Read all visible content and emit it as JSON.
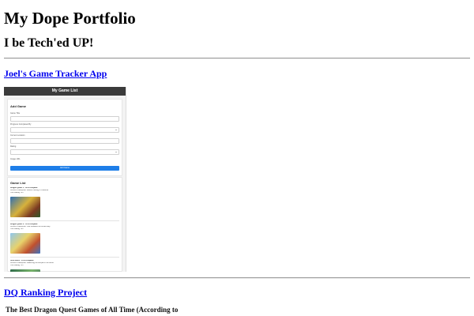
{
  "header": {
    "title": "My Dope Portfolio",
    "subtitle": "I be Tech'ed UP!"
  },
  "projects": [
    {
      "link_text": "Joel's Game Tracker App",
      "thumbnail": {
        "header_title": "My Game List",
        "add_section_title": "Add Game",
        "fields": [
          {
            "label": "Game Title"
          },
          {
            "label": "Progress Completed By"
          },
          {
            "label": "Current Location"
          },
          {
            "label": "Rating"
          },
          {
            "label": "Image URL"
          }
        ],
        "add_button_label": "Add Game",
        "list_title": "Game List",
        "games": [
          {
            "line1": "Dragon Quest 1 - 60% complete",
            "line2": "Current Checkpoint: Before moving to Charlock",
            "line3": "Your Rating: 3/5"
          },
          {
            "line1": "Dragon Quest 2 - 45% complete",
            "line2": "Current Checkpoint: Just obtained the Wizard key",
            "line3": "Your Rating: 4/5"
          },
          {
            "line1": "Ultra Sonic - 10% complete",
            "line2": "Current Checkpoint: Reaching the temple of the world",
            "line3": "Your Rating: 5/5"
          }
        ]
      }
    },
    {
      "link_text": "DQ Ranking Project",
      "description": "The Best Dragon Quest Games of All Time (According to"
    }
  ],
  "colors": {
    "link": "#0000ee",
    "thumb_header_bg": "#3b3b3b",
    "add_button": "#1e7ee8"
  }
}
